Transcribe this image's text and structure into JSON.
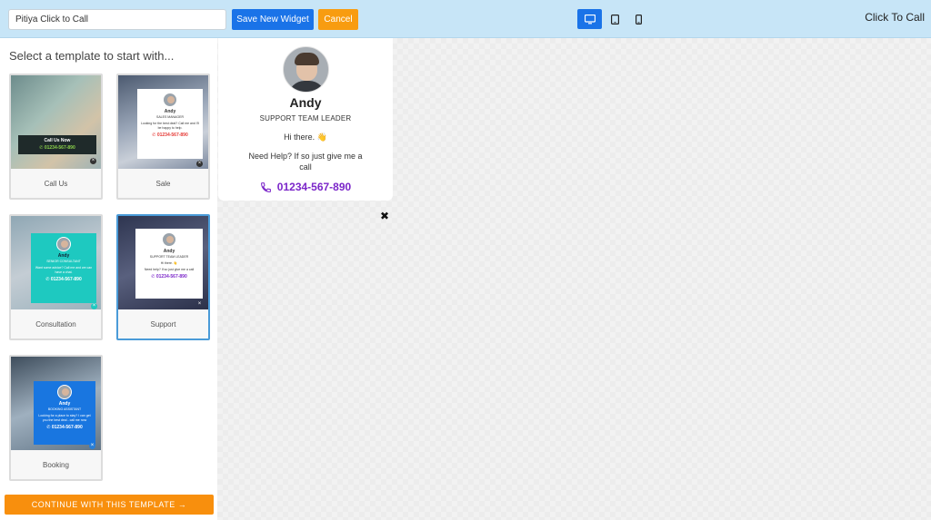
{
  "topbar": {
    "widget_name": "Pitiya Click to Call",
    "save_label": "Save New Widget",
    "cancel_label": "Cancel",
    "brand": "Click To Call",
    "devices": [
      {
        "name": "desktop-icon",
        "active": true
      },
      {
        "name": "tablet-icon",
        "active": false
      },
      {
        "name": "mobile-icon",
        "active": false
      }
    ]
  },
  "templates": {
    "title": "Select a template to start with...",
    "items": [
      {
        "label": "Call Us",
        "cta": "Call Us Now",
        "phone": "01234-567-890"
      },
      {
        "label": "Sale",
        "name": "Andy",
        "role": "SALES MANAGER",
        "text": "Looking for the best deal? Call me and I'll be happy to help.",
        "phone": "01234-567-890"
      },
      {
        "label": "Consultation",
        "name": "Andy",
        "role": "SENIOR CONSULTANT",
        "text": "Want some advice? Call me and we can have a chat.",
        "phone": "01234-567-890"
      },
      {
        "label": "Support",
        "name": "Andy",
        "role": "SUPPORT TEAM LEADER",
        "text": "Need help? If so just give me a call",
        "hi": "Hi there. 👋",
        "phone": "01234-567-890"
      },
      {
        "label": "Booking",
        "name": "Andy",
        "role": "BOOKING ASSISTANT",
        "text": "Looking for a place to stay? I can get you the best deal - call me now",
        "phone": "01234-567-890"
      }
    ],
    "continue_label": "CONTINUE WITH THIS TEMPLATE →"
  },
  "preview": {
    "name": "Andy",
    "role": "SUPPORT TEAM LEADER",
    "greeting": "Hi there. 👋",
    "help_text": "Need Help? If so just give me a call",
    "phone": "01234-567-890",
    "phone_color": "#7b26c9"
  },
  "colors": {
    "topbar": "#c7e5f7",
    "primary": "#1a73e8",
    "accent_orange": "#f89c10",
    "teal": "#1ec9c0",
    "booking_blue": "#1976e0"
  }
}
